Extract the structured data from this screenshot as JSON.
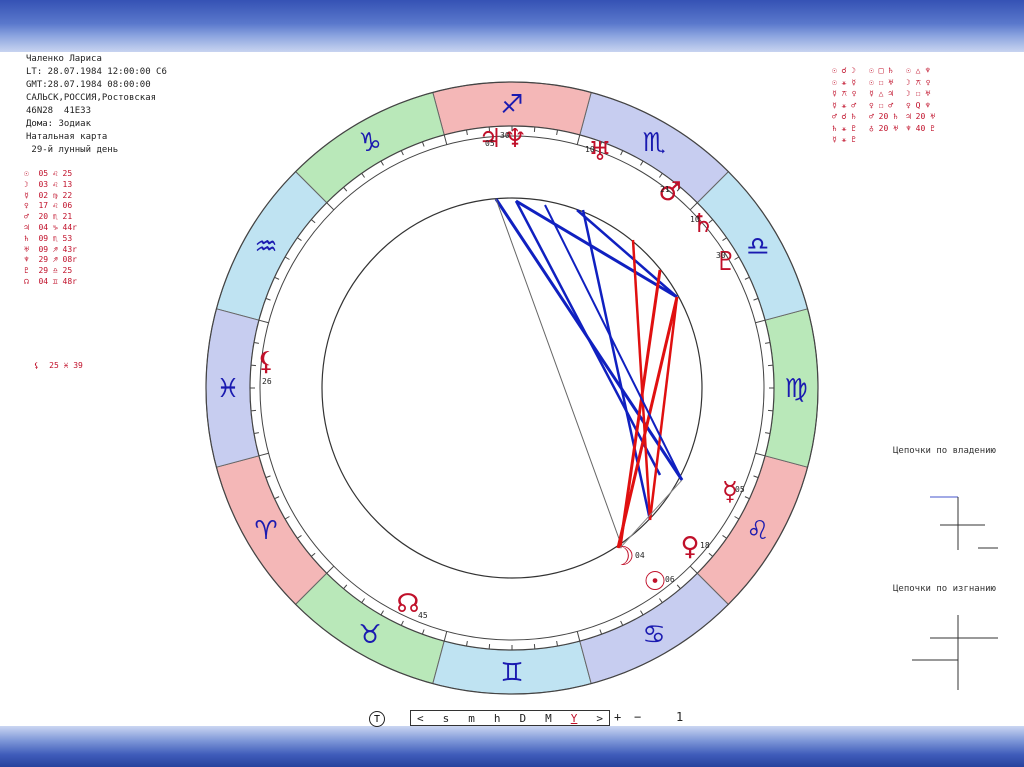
{
  "header": {
    "name": "Чаленко Лариса",
    "lt": "LT: 28.07.1984 12:00:00 С6",
    "gmt": "GMT:28.07.1984 08:00:00",
    "place": "САЛЬСК,РОССИЯ,Ростовская",
    "coords": "46N28  41E33",
    "houses": "Дома: Зодиак",
    "chart_type": "Натальная карта",
    "lunar_day": " 29-й лунный день"
  },
  "planets": [
    {
      "glyph": "☉",
      "pos": "05 ♌ 25"
    },
    {
      "glyph": "☽",
      "pos": "03 ♌ 13"
    },
    {
      "glyph": "☿",
      "pos": "02 ♍ 22"
    },
    {
      "glyph": "♀",
      "pos": "17 ♌ 06"
    },
    {
      "glyph": "♂",
      "pos": "20 ♏ 21"
    },
    {
      "glyph": "♃",
      "pos": "04 ♑ 44r"
    },
    {
      "glyph": "♄",
      "pos": "09 ♏ 53"
    },
    {
      "glyph": "♅",
      "pos": "09 ♐ 43r"
    },
    {
      "glyph": "♆",
      "pos": "29 ♐ 08r"
    },
    {
      "glyph": "♇",
      "pos": "29 ♎ 25"
    },
    {
      "glyph": "☊",
      "pos": "04 ♊ 48r"
    }
  ],
  "extra_point": {
    "glyph": "⚸",
    "pos": "25 ♓ 39"
  },
  "aspects": [
    [
      "☉ ☌ ☽",
      "☉ □ ♄",
      "☉ △ ♆"
    ],
    [
      "☉ ⚹ ☿",
      "☉ ☐ ♅",
      "☽ ⚻ ♀"
    ],
    [
      "☿ ⚻ ♀",
      "☿ △ ♃",
      "☽ ☐ ♅"
    ],
    [
      "☿ ⚹ ♂",
      "♀ ☐ ♂",
      "♀ Q ♆"
    ],
    [
      "♂ ☌ ♄",
      "♂ 20 ♄",
      "♃ 20 ♅"
    ],
    [
      "♄ ⚹ ♇",
      "♁ 20 ♅",
      "♆ 40 ♇"
    ],
    [
      "☿ ⚹ ♇",
      "",
      ""
    ]
  ],
  "chains": {
    "ownership_title": "Цепочки по владению",
    "exile_title": "Цепочки по изгнанию"
  },
  "timebar": {
    "left": "<",
    "units": [
      "s",
      "m",
      "h",
      "D",
      "M",
      "Y"
    ],
    "right": ">",
    "plus": "+",
    "minus": "−",
    "step": "1",
    "t_label": "T"
  },
  "wheel": {
    "signs": [
      "♈",
      "♉",
      "♊",
      "♋",
      "♌",
      "♍",
      "♎",
      "♏",
      "♐",
      "♑",
      "♒",
      "♓"
    ],
    "planet_labels": [
      {
        "glyph": "♃",
        "deg": "05"
      },
      {
        "glyph": "♆",
        "deg": "30"
      },
      {
        "glyph": "♅",
        "deg": "10"
      },
      {
        "glyph": "♂",
        "deg": "21"
      },
      {
        "glyph": "♄",
        "deg": "10"
      },
      {
        "glyph": "♇",
        "deg": "30"
      },
      {
        "glyph": "⚸",
        "deg": "26"
      },
      {
        "glyph": "☿",
        "deg": "05"
      },
      {
        "glyph": "♀",
        "deg": "18"
      },
      {
        "glyph": "☉",
        "deg": "06"
      },
      {
        "glyph": "☽",
        "deg": "04"
      },
      {
        "glyph": "☊",
        "deg": "45"
      }
    ]
  },
  "colors": {
    "fire": "#f4b7b7",
    "earth": "#b9e8b9",
    "air": "#bfe3f2",
    "water": "#c7cdf0",
    "planet": "#c0102a",
    "aspect_blue": "#1020c0",
    "aspect_red": "#e01010"
  }
}
